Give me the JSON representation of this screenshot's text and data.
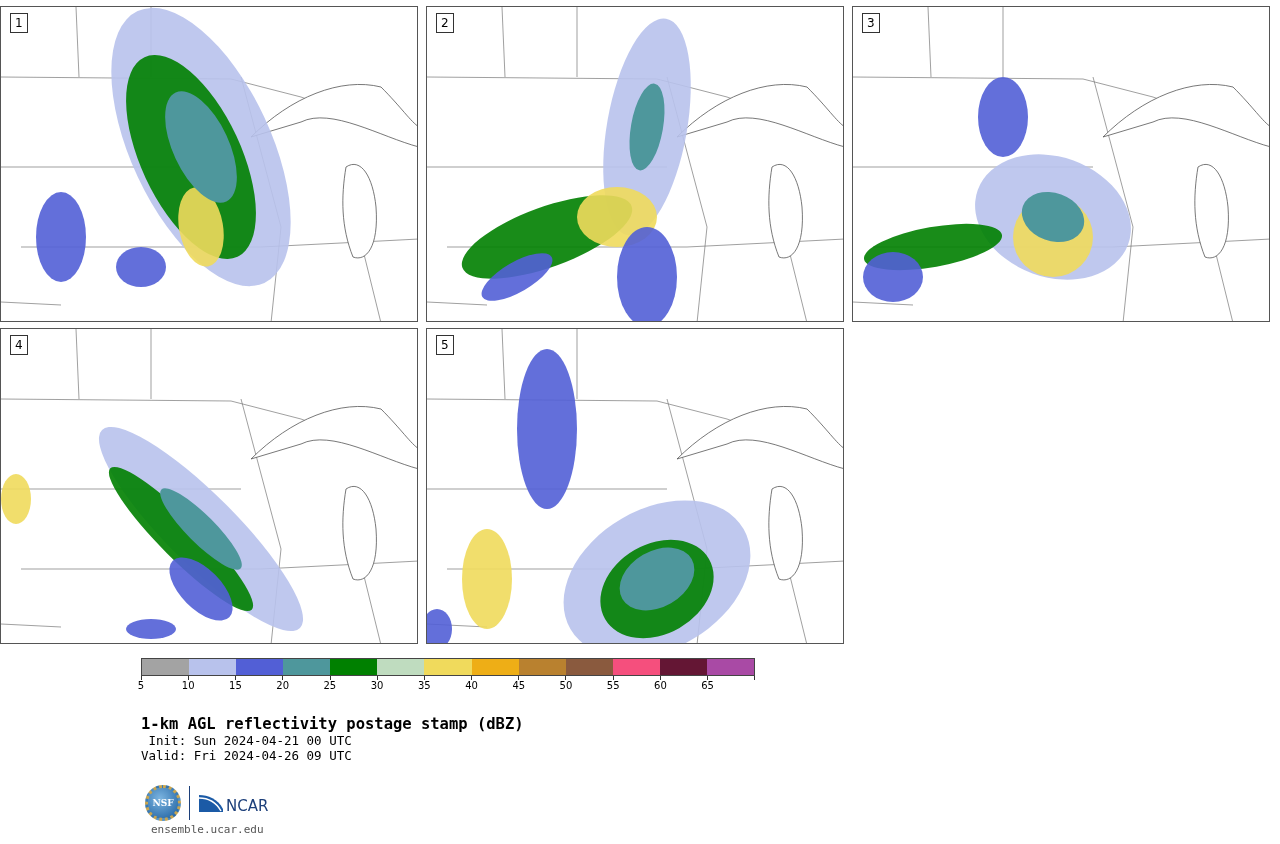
{
  "panels": [
    {
      "label": "1"
    },
    {
      "label": "2"
    },
    {
      "label": "3"
    },
    {
      "label": "4"
    },
    {
      "label": "5"
    }
  ],
  "colorbar": {
    "bins": [
      {
        "color": "#a3a3a3"
      },
      {
        "color": "#b8c2ec"
      },
      {
        "color": "#525fd6"
      },
      {
        "color": "#4e979c"
      },
      {
        "color": "#008000"
      },
      {
        "color": "#bfdcbf"
      },
      {
        "color": "#f0da5c"
      },
      {
        "color": "#eeae16"
      },
      {
        "color": "#b9812f"
      },
      {
        "color": "#8a5a3e"
      },
      {
        "color": "#f54f7d"
      },
      {
        "color": "#641634"
      },
      {
        "color": "#a94aa5"
      }
    ],
    "ticks": [
      "5",
      "10",
      "15",
      "20",
      "25",
      "30",
      "35",
      "40",
      "45",
      "50",
      "55",
      "60",
      "65"
    ]
  },
  "title": "1-km AGL reflectivity postage stamp (dBZ)",
  "init": " Init: Sun 2024-04-21 00 UTC",
  "valid": "Valid: Fri 2024-04-26 09 UTC",
  "logos": {
    "seal": "NSF",
    "org": "NCAR"
  },
  "url": "ensemble.ucar.edu"
}
